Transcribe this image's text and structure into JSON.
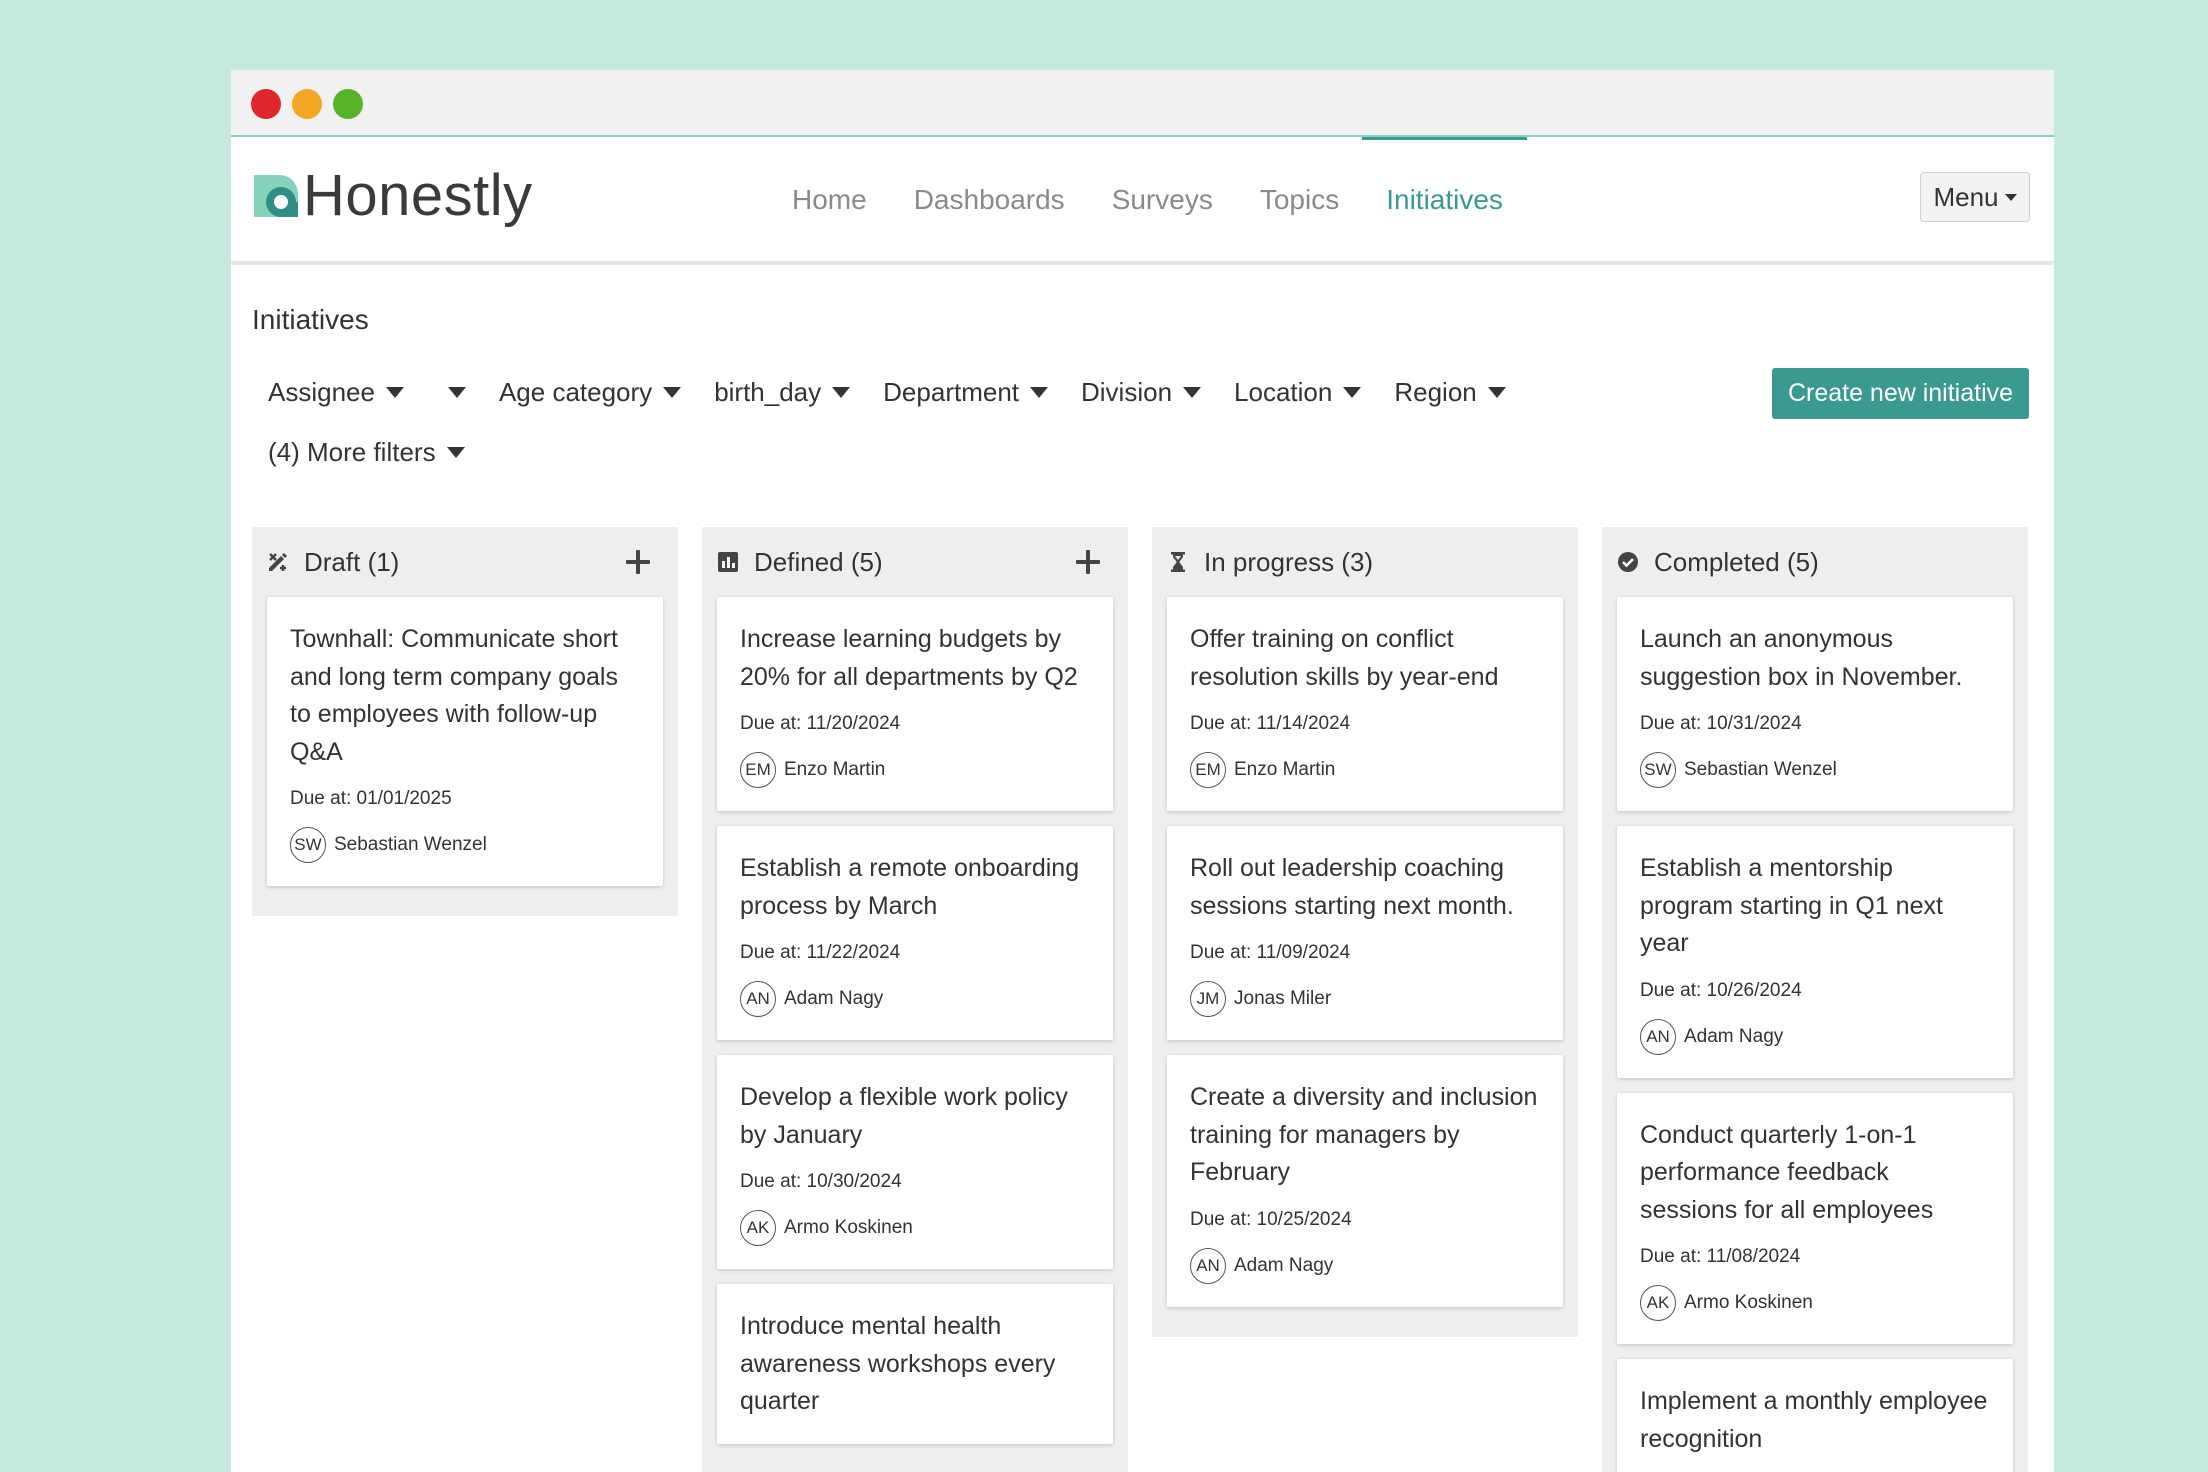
{
  "window": {
    "controls": [
      "close",
      "minimize",
      "maximize"
    ]
  },
  "brand": {
    "name": "Honestly",
    "logo_icon": "honestly-logo-icon",
    "accent": "#3a9a92"
  },
  "nav": {
    "items": [
      {
        "label": "Home",
        "active": false
      },
      {
        "label": "Dashboards",
        "active": false
      },
      {
        "label": "Surveys",
        "active": false
      },
      {
        "label": "Topics",
        "active": false
      },
      {
        "label": "Initiatives",
        "active": true
      }
    ],
    "menu_label": "Menu"
  },
  "page": {
    "title": "Initiatives",
    "create_button": "Create new initiative",
    "filters": [
      "Assignee",
      "",
      "Age category",
      "birth_day",
      "Department",
      "Division",
      "Location",
      "Region"
    ],
    "more_filters": "(4) More filters"
  },
  "columns": [
    {
      "title": "Draft (1)",
      "icon": "draft-pencil-icon",
      "addable": true,
      "cards": [
        {
          "title": "Townhall: Communicate short and long term company goals to employees with follow-up Q&A",
          "due": "Due at: 01/01/2025",
          "initials": "SW",
          "assignee": "Sebastian Wenzel"
        }
      ]
    },
    {
      "title": "Defined (5)",
      "icon": "chart-icon",
      "addable": true,
      "cards": [
        {
          "title": "Increase learning budgets by 20% for all departments by Q2",
          "due": "Due at: 11/20/2024",
          "initials": "EM",
          "assignee": "Enzo Martin"
        },
        {
          "title": "Establish a remote onboarding process by March",
          "due": "Due at: 11/22/2024",
          "initials": "AN",
          "assignee": "Adam Nagy"
        },
        {
          "title": "Develop a flexible work policy by January",
          "due": "Due at: 10/30/2024",
          "initials": "AK",
          "assignee": "Armo Koskinen"
        },
        {
          "title": "Introduce mental health awareness workshops every quarter",
          "due": "",
          "initials": "",
          "assignee": ""
        }
      ]
    },
    {
      "title": "In progress (3)",
      "icon": "hourglass-icon",
      "addable": false,
      "cards": [
        {
          "title": "Offer training on conflict resolution skills by year-end",
          "due": "Due at: 11/14/2024",
          "initials": "EM",
          "assignee": "Enzo Martin"
        },
        {
          "title": "Roll out leadership coaching sessions starting next month.",
          "due": "Due at: 11/09/2024",
          "initials": "JM",
          "assignee": "Jonas Miler"
        },
        {
          "title": "Create a diversity and inclusion training for managers by February",
          "due": "Due at: 10/25/2024",
          "initials": "AN",
          "assignee": "Adam Nagy"
        }
      ]
    },
    {
      "title": "Completed (5)",
      "icon": "check-circle-icon",
      "addable": false,
      "cards": [
        {
          "title": "Launch an anonymous suggestion box in November.",
          "due": "Due at: 10/31/2024",
          "initials": "SW",
          "assignee": "Sebastian Wenzel"
        },
        {
          "title": "Establish a mentorship program starting in Q1 next year",
          "due": "Due at: 10/26/2024",
          "initials": "AN",
          "assignee": "Adam Nagy"
        },
        {
          "title": "Conduct quarterly 1-on-1 performance feedback sessions for all employees",
          "due": "Due at: 11/08/2024",
          "initials": "AK",
          "assignee": "Armo Koskinen"
        },
        {
          "title": "Implement a monthly employee recognition",
          "due": "",
          "initials": "",
          "assignee": ""
        }
      ]
    }
  ]
}
